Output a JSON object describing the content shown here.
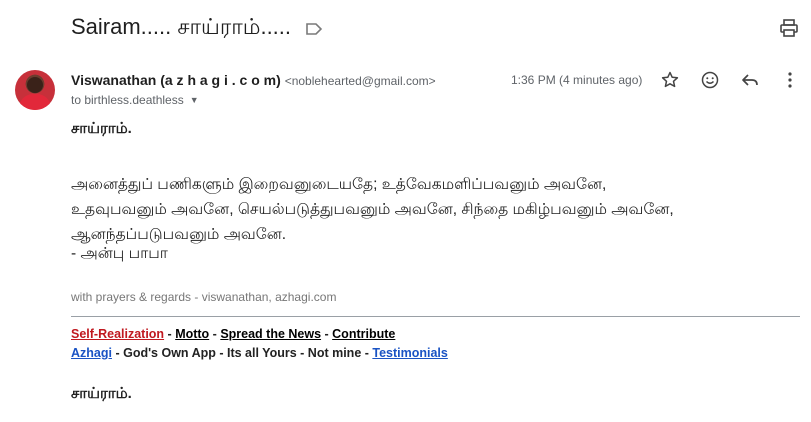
{
  "subject": "Sairam..... சாய்ராம்.....",
  "sender": {
    "name": "Viswanathan (a z h a g i . c o m)",
    "email": "<noblehearted@gmail.com>",
    "to": "to birthless.deathless",
    "time": "1:36 PM (4 minutes ago)"
  },
  "body": {
    "greeting": "சாய்ராம்.",
    "line1": "அனைத்துப் பணிகளும் இறைவனுடையதே; உத்வேகமளிப்பவனும் அவனே,",
    "line2": "உதவுபவனும் அவனே, செயல்படுத்துபவனும் அவனே, சிந்தை மகிழ்பவனும் அவனே,",
    "line3": "ஆனந்தப்படுபவனும் அவனே.",
    "signature": "- அன்பு பாபா",
    "regards": "with prayers & regards - viswanathan, azhagi.com",
    "closing": "சாய்ராம்."
  },
  "links": {
    "self_realization": "Self-Realization",
    "motto": "Motto",
    "spread_news": "Spread the News",
    "contribute": "Contribute",
    "azhagi": "Azhagi",
    "gods_own_app": "God's Own App - Its all Yours - Not mine",
    "testimonials": "Testimonials",
    "separator": " - "
  },
  "icons": {
    "label": "label-outline-icon",
    "print": "print-icon",
    "star": "star-outline-icon",
    "emoji": "emoji-icon",
    "reply": "reply-icon",
    "more": "more-vert-icon"
  },
  "colors": {
    "link_red": "#c0181f",
    "link_blue": "#1a53c4",
    "avatar_bg": "#c7303a"
  }
}
